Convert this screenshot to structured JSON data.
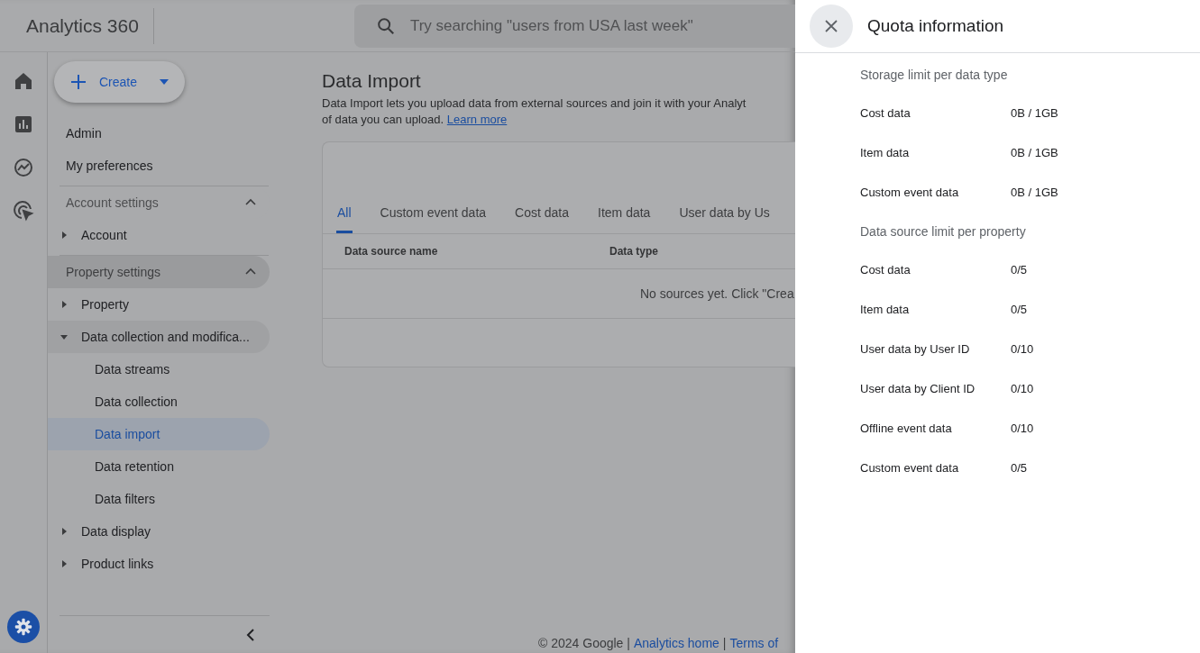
{
  "app": {
    "name": "Analytics 360"
  },
  "search": {
    "placeholder": "Try searching \"users from USA last week\""
  },
  "create_button": {
    "label": "Create"
  },
  "nav": {
    "top_items": [
      "Admin",
      "My preferences"
    ],
    "sections": [
      {
        "title": "Account settings",
        "expanded": true,
        "active": false,
        "items": [
          {
            "label": "Account",
            "expanded": false,
            "selected": false
          }
        ]
      },
      {
        "title": "Property settings",
        "expanded": true,
        "active": true,
        "items": [
          {
            "label": "Property",
            "expanded": false,
            "selected": false
          },
          {
            "label": "Data collection and modifica...",
            "expanded": true,
            "selected": false,
            "children": [
              {
                "label": "Data streams",
                "selected": false
              },
              {
                "label": "Data collection",
                "selected": false
              },
              {
                "label": "Data import",
                "selected": true
              },
              {
                "label": "Data retention",
                "selected": false
              },
              {
                "label": "Data filters",
                "selected": false
              }
            ]
          },
          {
            "label": "Data display",
            "expanded": false,
            "selected": false
          },
          {
            "label": "Product links",
            "expanded": false,
            "selected": false
          }
        ]
      }
    ]
  },
  "page": {
    "title": "Data Import",
    "description_line_1": "Data Import lets you upload data from external sources and join it with your Analyt",
    "description_line_2": "of data you can upload.",
    "learn_more": "Learn more",
    "tabs": [
      {
        "label": "All",
        "selected": true
      },
      {
        "label": "Custom event data",
        "selected": false
      },
      {
        "label": "Cost data",
        "selected": false
      },
      {
        "label": "Item data",
        "selected": false
      },
      {
        "label": "User data by Us",
        "selected": false
      }
    ],
    "table": {
      "columns": [
        "Data source name",
        "Data type"
      ],
      "empty_message": "No sources yet. Click \"Crea"
    }
  },
  "footer": {
    "copyright": "© 2024 Google |",
    "links": [
      "Analytics home",
      "Terms of"
    ],
    "separator": "|"
  },
  "drawer": {
    "title": "Quota information",
    "sections": [
      {
        "heading": "Storage limit per data type",
        "rows": [
          {
            "label": "Cost data",
            "value": "0B / 1GB"
          },
          {
            "label": "Item data",
            "value": "0B / 1GB"
          },
          {
            "label": "Custom event data",
            "value": "0B / 1GB"
          }
        ]
      },
      {
        "heading": "Data source limit per property",
        "rows": [
          {
            "label": "Cost data",
            "value": "0/5"
          },
          {
            "label": "Item data",
            "value": "0/5"
          },
          {
            "label": "User data by User ID",
            "value": "0/10"
          },
          {
            "label": "User data by Client ID",
            "value": "0/10"
          },
          {
            "label": "Offline event data",
            "value": "0/10"
          },
          {
            "label": "Custom event data",
            "value": "0/5"
          }
        ]
      }
    ]
  }
}
